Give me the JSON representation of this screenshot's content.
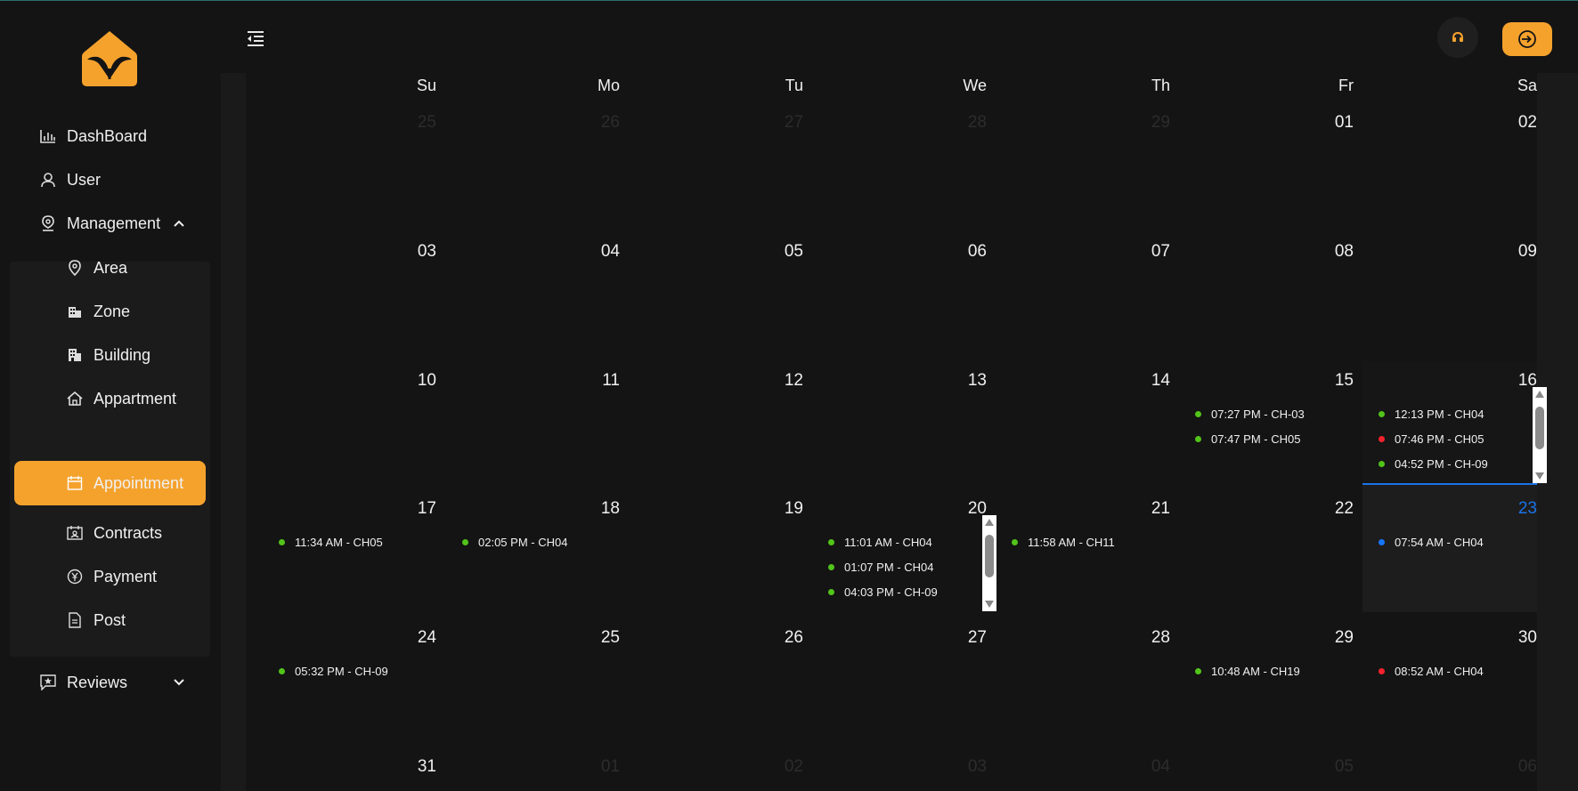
{
  "sidebar": {
    "items": [
      {
        "label": "DashBoard",
        "icon": "bar-chart-icon"
      },
      {
        "label": "User",
        "icon": "user-icon"
      },
      {
        "label": "Management",
        "icon": "pin-icon"
      },
      {
        "label": "Reviews",
        "icon": "star-message-icon"
      }
    ],
    "sub_items": [
      {
        "label": "Area",
        "icon": "location-icon"
      },
      {
        "label": "Zone",
        "icon": "buildings-icon"
      },
      {
        "label": "Building",
        "icon": "building-icon"
      },
      {
        "label": "Appartment",
        "icon": "home-icon"
      },
      {
        "label": "Appointment",
        "icon": "calendar-icon"
      },
      {
        "label": "Contracts",
        "icon": "contract-icon"
      },
      {
        "label": "Payment",
        "icon": "yen-icon"
      },
      {
        "label": "Post",
        "icon": "document-icon"
      }
    ],
    "active": "Appointment"
  },
  "colors": {
    "accent": "#f5a22d",
    "today": "#1a73e8",
    "green": "#52c41a",
    "red": "#f5222d",
    "blue": "#1677ff"
  },
  "calendar": {
    "weekdays": [
      "Su",
      "Mo",
      "Tu",
      "We",
      "Th",
      "Fr",
      "Sa"
    ],
    "weeks": [
      [
        "25",
        "26",
        "27",
        "28",
        "29",
        "01",
        "02"
      ],
      [
        "03",
        "04",
        "05",
        "06",
        "07",
        "08",
        "09"
      ],
      [
        "10",
        "11",
        "12",
        "13",
        "14",
        "15",
        "16"
      ],
      [
        "17",
        "18",
        "19",
        "20",
        "21",
        "22",
        "23"
      ],
      [
        "24",
        "25",
        "26",
        "27",
        "28",
        "29",
        "30"
      ],
      [
        "31",
        "01",
        "02",
        "03",
        "04",
        "05",
        "06"
      ]
    ],
    "today": "23",
    "events": {
      "w2d5": [
        {
          "text": "07:27 PM - CH-03",
          "status": "green"
        },
        {
          "text": "07:47 PM - CH05",
          "status": "green"
        }
      ],
      "w2d6": [
        {
          "text": "12:13 PM - CH04",
          "status": "green"
        },
        {
          "text": "07:46 PM - CH05",
          "status": "red"
        },
        {
          "text": "04:52 PM - CH-09",
          "status": "green"
        }
      ],
      "w3d0": [
        {
          "text": "11:34 AM - CH05",
          "status": "green"
        }
      ],
      "w3d1": [
        {
          "text": "02:05 PM - CH04",
          "status": "green"
        }
      ],
      "w3d3": [
        {
          "text": "11:01 AM - CH04",
          "status": "green"
        },
        {
          "text": "01:07 PM - CH04",
          "status": "green"
        },
        {
          "text": "04:03 PM - CH-09",
          "status": "green"
        }
      ],
      "w3d4": [
        {
          "text": "11:58 AM - CH11",
          "status": "green"
        }
      ],
      "w3d6": [
        {
          "text": "07:54 AM - CH04",
          "status": "blue"
        }
      ],
      "w4d0": [
        {
          "text": "05:32 PM - CH-09",
          "status": "green"
        }
      ],
      "w4d5": [
        {
          "text": "10:48 AM - CH19",
          "status": "green"
        }
      ],
      "w4d6": [
        {
          "text": "08:52 AM - CH04",
          "status": "red"
        }
      ]
    }
  }
}
